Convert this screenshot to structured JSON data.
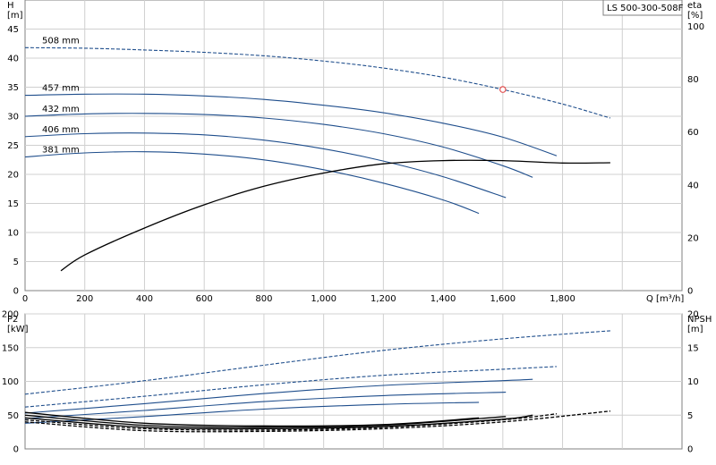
{
  "model": "LS 500-300-508F",
  "chart_data": [
    {
      "type": "line",
      "panel": "head-efficiency",
      "x_axis": {
        "label": "Q [m³/h]",
        "range": [
          0,
          2200
        ],
        "ticks": [
          0,
          200,
          400,
          600,
          800,
          1000,
          1200,
          1400,
          1600,
          1800
        ],
        "tick_labels": [
          "0",
          "200",
          "400",
          "600",
          "800",
          "1,000",
          "1,200",
          "1,400",
          "1,600",
          "1,800"
        ]
      },
      "y_left": {
        "label_top": "H",
        "label_unit": "[m]",
        "range": [
          0,
          50
        ],
        "ticks": [
          0,
          5,
          10,
          15,
          20,
          25,
          30,
          35,
          40,
          45
        ]
      },
      "y_right": {
        "label_top": "eta",
        "label_unit": "[%]",
        "range": [
          0,
          110
        ],
        "ticks": [
          0,
          20,
          40,
          60,
          80,
          100
        ]
      },
      "grid": true,
      "series": [
        {
          "name": "508 mm",
          "dash": true,
          "color": "#1f4e8c",
          "x": [
            0,
            200,
            400,
            600,
            800,
            1000,
            1200,
            1400,
            1600,
            1800,
            1960
          ],
          "y": [
            41.8,
            41.7,
            41.4,
            41.0,
            40.4,
            39.5,
            38.3,
            36.7,
            34.6,
            32.1,
            29.7
          ]
        },
        {
          "name": "457 mm",
          "color": "#1f4e8c",
          "x": [
            0,
            200,
            400,
            600,
            800,
            1000,
            1200,
            1400,
            1600,
            1780
          ],
          "y": [
            33.6,
            33.8,
            33.8,
            33.5,
            32.9,
            31.9,
            30.6,
            28.8,
            26.4,
            23.2
          ]
        },
        {
          "name": "432 mm",
          "color": "#1f4e8c",
          "x": [
            0,
            200,
            400,
            600,
            800,
            1000,
            1200,
            1400,
            1600,
            1700
          ],
          "y": [
            30.0,
            30.4,
            30.5,
            30.3,
            29.7,
            28.6,
            27.0,
            24.7,
            21.5,
            19.5
          ]
        },
        {
          "name": "406 mm",
          "color": "#1f4e8c",
          "x": [
            0,
            200,
            400,
            600,
            800,
            1000,
            1200,
            1400,
            1610
          ],
          "y": [
            26.5,
            27.0,
            27.1,
            26.8,
            25.9,
            24.4,
            22.3,
            19.6,
            16.0
          ]
        },
        {
          "name": "381 mm",
          "color": "#1f4e8c",
          "x": [
            0,
            200,
            400,
            600,
            800,
            1000,
            1200,
            1400,
            1520
          ],
          "y": [
            23.0,
            23.7,
            23.9,
            23.5,
            22.5,
            20.8,
            18.5,
            15.6,
            13.3
          ]
        },
        {
          "name": "eta",
          "color": "#000000",
          "axis": "right",
          "x": [
            120,
            200,
            400,
            600,
            800,
            1000,
            1200,
            1400,
            1600,
            1800,
            1960
          ],
          "y": [
            7.5,
            13.5,
            23.7,
            32.5,
            39.5,
            44.5,
            48.0,
            49.2,
            49.2,
            48.3,
            48.4
          ]
        }
      ],
      "annotations": [
        {
          "type": "marker",
          "x": 1600,
          "y": 34.6,
          "color": "#e05050"
        }
      ]
    },
    {
      "type": "line",
      "panel": "power-npsh",
      "y_left": {
        "label_top": "P2",
        "label_unit": "[kW]",
        "range": [
          0,
          200
        ],
        "ticks": [
          0,
          50,
          100,
          150,
          200
        ]
      },
      "y_right": {
        "label_top": "NPSH",
        "label_unit": "[m]",
        "range": [
          0,
          20
        ],
        "ticks": [
          0,
          5,
          10,
          15,
          20
        ]
      },
      "grid": true,
      "series": [
        {
          "name": "P2 508 mm",
          "dash": true,
          "color": "#1f4e8c",
          "x": [
            0,
            400,
            800,
            1200,
            1600,
            1960
          ],
          "y": [
            81,
            101,
            124,
            146,
            163,
            175
          ]
        },
        {
          "name": "P2 457 mm",
          "dash": true,
          "color": "#1f4e8c",
          "x": [
            0,
            400,
            800,
            1200,
            1600,
            1780
          ],
          "y": [
            62,
            78,
            95,
            109,
            118,
            122
          ]
        },
        {
          "name": "P2 432 mm",
          "color": "#1f4e8c",
          "x": [
            0,
            400,
            800,
            1200,
            1600,
            1700
          ],
          "y": [
            53,
            67,
            82,
            94,
            101,
            103
          ]
        },
        {
          "name": "P2 406 mm",
          "color": "#1f4e8c",
          "x": [
            0,
            400,
            800,
            1200,
            1610
          ],
          "y": [
            45,
            57,
            70,
            79,
            84
          ]
        },
        {
          "name": "P2 381 mm",
          "color": "#1f4e8c",
          "x": [
            0,
            400,
            800,
            1200,
            1520
          ],
          "y": [
            38,
            48,
            59,
            66,
            69
          ]
        },
        {
          "name": "NPSH 508 mm",
          "dash": true,
          "color": "#000000",
          "axis": "right",
          "x": [
            0,
            400,
            800,
            1200,
            1600,
            1960
          ],
          "y": [
            4.0,
            2.7,
            2.6,
            3.0,
            4.0,
            5.6
          ]
        },
        {
          "name": "NPSH 457 mm",
          "dash": true,
          "color": "#000000",
          "axis": "right",
          "x": [
            0,
            400,
            800,
            1200,
            1600,
            1780
          ],
          "y": [
            4.3,
            3.0,
            2.8,
            3.2,
            4.3,
            5.2
          ]
        },
        {
          "name": "NPSH 432 mm",
          "color": "#000000",
          "axis": "right",
          "x": [
            0,
            400,
            800,
            1200,
            1600,
            1700
          ],
          "y": [
            4.6,
            3.2,
            3.0,
            3.3,
            4.4,
            5.0
          ]
        },
        {
          "name": "NPSH 406 mm",
          "color": "#000000",
          "axis": "right",
          "x": [
            0,
            400,
            800,
            1200,
            1610
          ],
          "y": [
            5.0,
            3.5,
            3.2,
            3.5,
            4.8
          ]
        },
        {
          "name": "NPSH 381 mm",
          "color": "#000000",
          "axis": "right",
          "x": [
            0,
            400,
            800,
            1200,
            1520
          ],
          "y": [
            5.4,
            3.8,
            3.4,
            3.6,
            4.6
          ]
        }
      ]
    }
  ]
}
